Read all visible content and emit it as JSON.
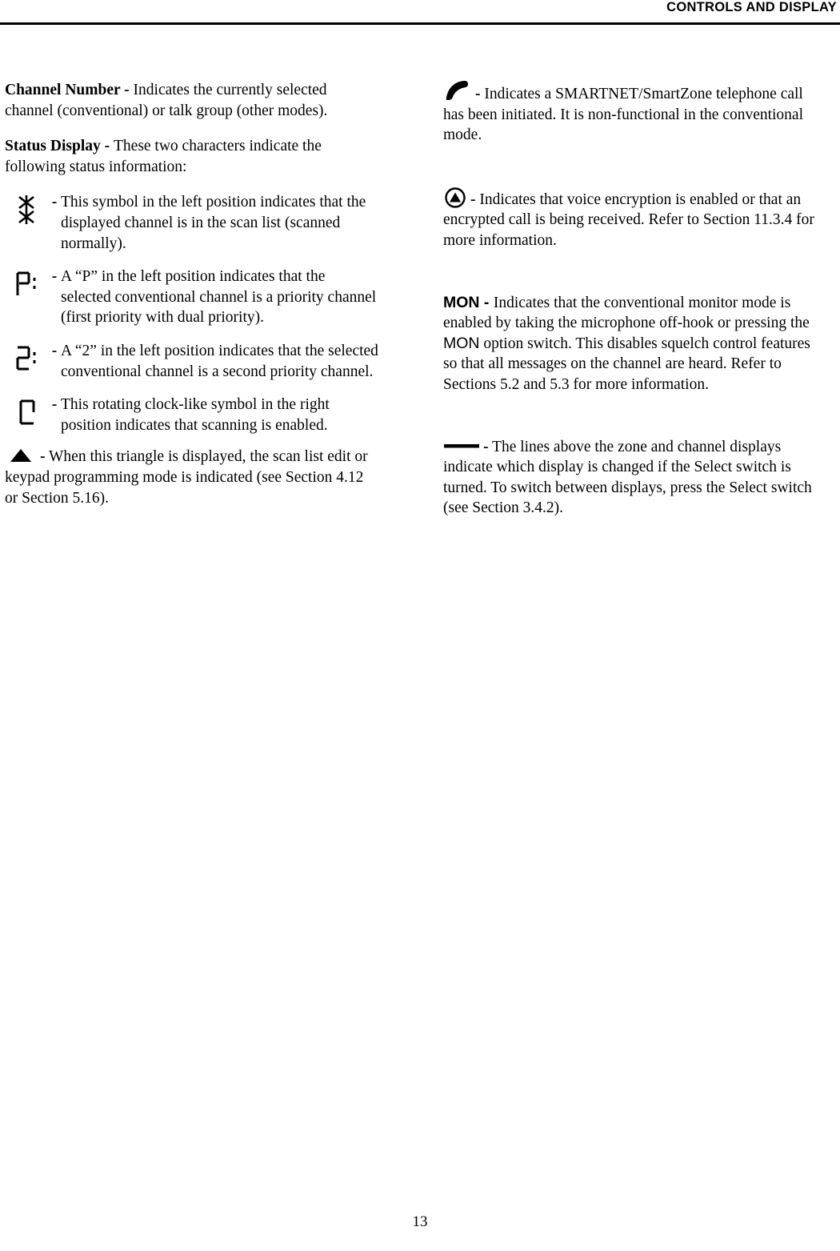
{
  "header": {
    "title": "CONTROLS AND DISPLAY"
  },
  "footer": {
    "page_number": "13"
  },
  "left_column": {
    "channel_number": {
      "term": "Channel Number - ",
      "text": "Indicates the currently selected channel (conventional) or talk group (other modes)."
    },
    "status_display": {
      "term": "Status Display - ",
      "text": "These two characters indicate the following status information:"
    },
    "items": [
      {
        "icon": "scan-list-symbol-icon",
        "dash": "-",
        "text": "This symbol in the left position indicates that the displayed channel is in the scan list (scanned normally)."
      },
      {
        "icon": "priority-p-icon",
        "dash": "-",
        "text": "A “P” in the left position indicates that the selected conventional channel is a priority channel (first priority with dual priority)."
      },
      {
        "icon": "priority-2-icon",
        "dash": "-",
        "text": "A “2” in the left position indicates that the selected conventional channel is a second priority channel."
      },
      {
        "icon": "rotating-clock-icon",
        "dash": "-",
        "text": "This rotating clock-like symbol in the right position indicates that scanning is enabled."
      }
    ],
    "triangle_note": {
      "icon": "triangle-icon",
      "dash": "-",
      "text": "When this triangle is displayed, the scan list edit or keypad programming mode is indicated (see Section 4.12 or Section 5.16)."
    }
  },
  "right_column": {
    "telephone": {
      "icon": "telephone-handset-icon",
      "dash": "-",
      "text": "Indicates a SMARTNET/SmartZone telephone call has been initiated. It is non-functional in the conventional mode."
    },
    "encryption": {
      "icon": "encryption-circle-triangle-icon",
      "dash": "-",
      "text": "Indicates that voice encryption is enabled or that an encrypted call is being received. Refer to Section 11.3.4 for more information."
    },
    "mon": {
      "term": "MON - ",
      "text_before": "Indicates that the conventional monitor mode is enabled by taking the microphone off-hook or pressing the ",
      "inline_label": "MON",
      "text_after": " option switch. This disables squelch control features so that all messages on the channel are heard. Refer to Sections 5.2 and 5.3 for more information."
    },
    "lines": {
      "icon": "select-lines-icon",
      "dash": "-",
      "text": "The lines above the zone and channel displays indicate which display is changed if the Select switch is turned. To switch between displays, press the Select switch (see Section 3.4.2)."
    }
  }
}
